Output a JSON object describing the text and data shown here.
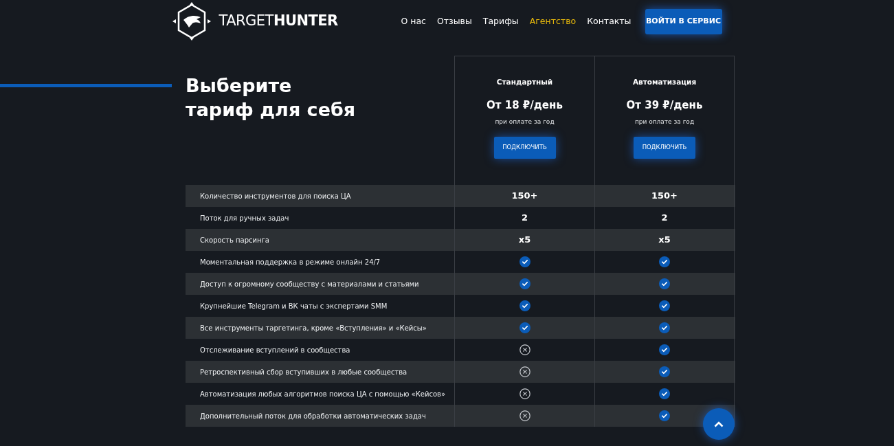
{
  "logo": {
    "text": "TARGET**HUNTER**"
  },
  "nav": [
    {
      "label": "О нас",
      "selected": false
    },
    {
      "label": "Отзывы",
      "selected": false
    },
    {
      "label": "Тарифы",
      "selected": false
    },
    {
      "label": "Агентство",
      "selected": true
    },
    {
      "label": "Контакты",
      "selected": false
    }
  ],
  "login_button": "ВОЙТИ В СЕРВИС",
  "heading": "Выберите тариф для себя",
  "plans": [
    {
      "name": "Стандартный",
      "price": "От 18 ₽/день",
      "note": "при оплате за год",
      "button": "ПОДКЛЮЧИТЬ"
    },
    {
      "name": "Автоматизация",
      "price": "От 39 ₽/день",
      "note": "при оплате за год",
      "button": "ПОДКЛЮЧИТЬ"
    }
  ],
  "features": [
    {
      "label": "Количество инструментов для поиска ЦА",
      "cells": [
        {
          "kind": "text",
          "text": "150+"
        },
        {
          "kind": "text",
          "text": "150+"
        }
      ]
    },
    {
      "label": "Поток для ручных задач",
      "cells": [
        {
          "kind": "text",
          "text": "2"
        },
        {
          "kind": "text",
          "text": "2"
        }
      ]
    },
    {
      "label": "Скорость парсинга",
      "cells": [
        {
          "kind": "text",
          "text": "x5"
        },
        {
          "kind": "text",
          "text": "x5"
        }
      ]
    },
    {
      "label": "Моментальная поддержка в режиме онлайн 24/7",
      "cells": [
        {
          "kind": "check"
        },
        {
          "kind": "check"
        }
      ]
    },
    {
      "label": "Доступ к огромному сообществу с материалами и статьями",
      "cells": [
        {
          "kind": "check"
        },
        {
          "kind": "check"
        }
      ]
    },
    {
      "label": "Крупнейшие Telegram и ВК чаты с экспертами SMM",
      "cells": [
        {
          "kind": "check"
        },
        {
          "kind": "check"
        }
      ]
    },
    {
      "label": "Все инструменты таргетинга, кроме «Вступления» и «Кейсы»",
      "cells": [
        {
          "kind": "check"
        },
        {
          "kind": "check"
        }
      ]
    },
    {
      "label": "Отслеживание вступлений в сообщества",
      "cells": [
        {
          "kind": "cross"
        },
        {
          "kind": "check"
        }
      ]
    },
    {
      "label": "Ретроспективный сбор вступивших в любые сообщества",
      "cells": [
        {
          "kind": "cross"
        },
        {
          "kind": "check"
        }
      ]
    },
    {
      "label": "Автоматизация любых алгоритмов поиска ЦА с помощью «Кейсов»",
      "cells": [
        {
          "kind": "cross"
        },
        {
          "kind": "check"
        }
      ]
    },
    {
      "label": "Дополнительный поток для обработки автоматических задач",
      "cells": [
        {
          "kind": "cross"
        },
        {
          "kind": "check"
        }
      ]
    }
  ]
}
